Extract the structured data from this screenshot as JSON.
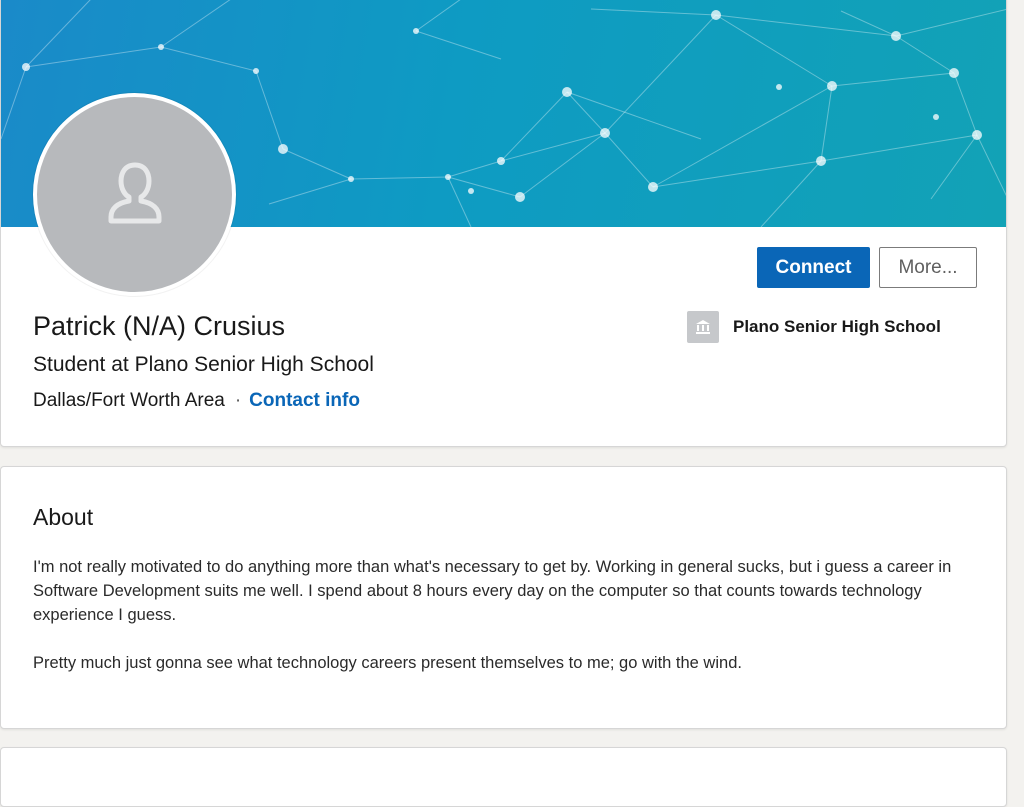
{
  "profile": {
    "name": "Patrick (N/A) Crusius",
    "headline": "Student at Plano Senior High School",
    "location": "Dallas/Fort Worth Area",
    "separator": "·",
    "contact_label": "Contact info"
  },
  "actions": {
    "connect_label": "Connect",
    "more_label": "More..."
  },
  "education": {
    "school_name": "Plano Senior High School",
    "icon": "school-icon"
  },
  "about": {
    "title": "About",
    "paragraphs": [
      "I'm not really motivated to do anything more than what's necessary to get by. Working in general sucks, but i guess a career in Software Development suits me well. I spend about 8 hours every day on the computer so that counts towards technology experience I guess.",
      "Pretty much just gonna see what technology careers present themselves to me; go with the wind."
    ]
  },
  "colors": {
    "accent": "#0a66b7",
    "banner_start": "#1a8ac9",
    "banner_end": "#12a2b6",
    "avatar_bg": "#b7b9bc"
  }
}
